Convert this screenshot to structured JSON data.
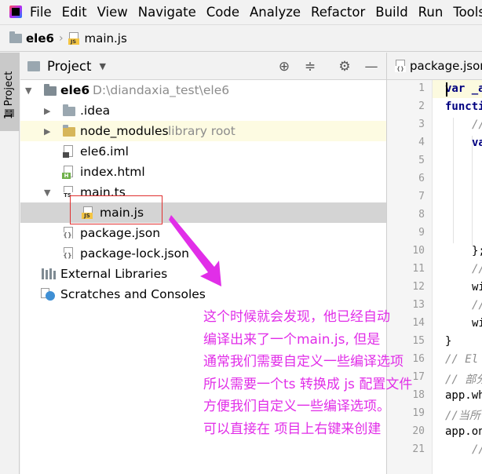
{
  "menu": [
    "File",
    "Edit",
    "View",
    "Navigate",
    "Code",
    "Analyze",
    "Refactor",
    "Build",
    "Run",
    "Tools"
  ],
  "breadcrumb": {
    "project": "ele6",
    "file": "main.js"
  },
  "tool_stripe": {
    "project_tab": "1: Project"
  },
  "project_panel": {
    "title": "Project",
    "tree": {
      "root": {
        "name": "ele6",
        "path": "D:\\diandaxia_test\\ele6"
      },
      "idea": ".idea",
      "node_modules": {
        "name": "node_modules",
        "hint": "library root"
      },
      "ele6_iml": "ele6.iml",
      "index_html": "index.html",
      "main_ts": "main.ts",
      "main_js": "main.js",
      "package_json": "package.json",
      "package_lock": "package-lock.json",
      "external_libraries": "External Libraries",
      "scratches": "Scratches and Consoles"
    }
  },
  "editor": {
    "tab": "package.json",
    "line_numbers": [
      "1",
      "2",
      "3",
      "4",
      "5",
      "6",
      "7",
      "8",
      "9",
      "10",
      "11",
      "12",
      "13",
      "14",
      "15",
      "16",
      "17",
      "18",
      "19",
      "20",
      "21"
    ],
    "lines": {
      "l1": "var _a",
      "l2": "functi",
      "l3": "//",
      "l4": "va",
      "l10": "};",
      "l11": "//",
      "l12": "wi",
      "l13": "//",
      "l14": "wi",
      "l15": "}",
      "l16": "// El",
      "l17": "// 部分",
      "l18": "app.wh",
      "l19": "//当所",
      "l20": "app.on",
      "l21": "//"
    }
  },
  "annotation": {
    "color": "#e12ee8",
    "lines": [
      "这个时候就会发现，他已经自动",
      "编译出来了一个main.js, 但是",
      "通常我们需要自定义一些编译选项",
      "所以需要一个ts 转换成 js 配置文件",
      "方便我们自定义一些编译选项。",
      "可以直接在 项目上右键来创建"
    ]
  }
}
